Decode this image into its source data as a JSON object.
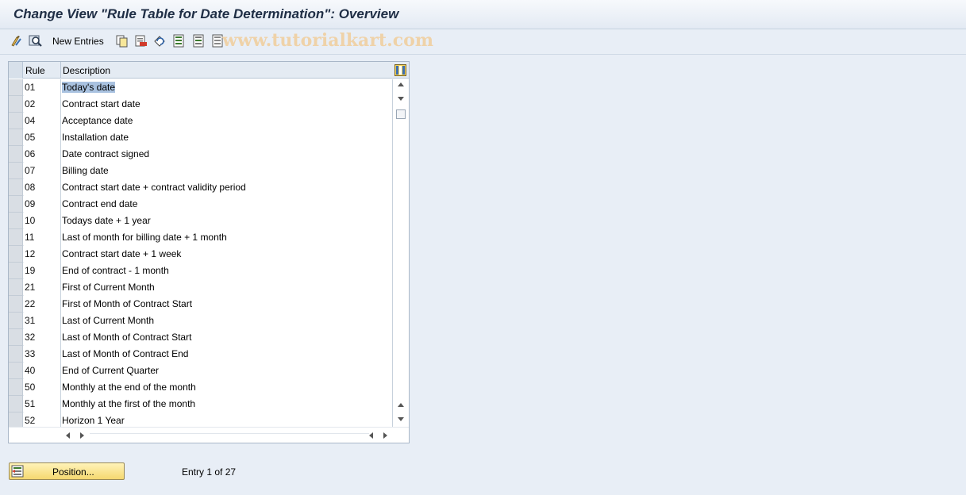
{
  "title": "Change View \"Rule Table for Date Determination\": Overview",
  "toolbar": {
    "icons": [
      "display-change-icon",
      "find-icon",
      "copy-as-icon",
      "delete-icon",
      "undo-icon",
      "select-all-icon",
      "select-block-icon",
      "deselect-all-icon"
    ],
    "new_entries_label": "New Entries",
    "watermark": "www.tutorialkart.com"
  },
  "table": {
    "columns": {
      "rule": "Rule",
      "description": "Description"
    },
    "rows": [
      {
        "rule": "01",
        "description": "Today's date"
      },
      {
        "rule": "02",
        "description": "Contract start date"
      },
      {
        "rule": "04",
        "description": "Acceptance date"
      },
      {
        "rule": "05",
        "description": "Installation date"
      },
      {
        "rule": "06",
        "description": "Date contract signed"
      },
      {
        "rule": "07",
        "description": "Billing date"
      },
      {
        "rule": "08",
        "description": "Contract start date + contract validity period"
      },
      {
        "rule": "09",
        "description": "Contract end date"
      },
      {
        "rule": "10",
        "description": "Todays date + 1 year"
      },
      {
        "rule": "11",
        "description": "Last of month for billing date + 1 month"
      },
      {
        "rule": "12",
        "description": "Contract start date + 1 week"
      },
      {
        "rule": "19",
        "description": "End of contract - 1 month"
      },
      {
        "rule": "21",
        "description": "First of Current Month"
      },
      {
        "rule": "22",
        "description": "First of Month of Contract Start"
      },
      {
        "rule": "31",
        "description": "Last of Current Month"
      },
      {
        "rule": "32",
        "description": "Last of Month of Contract Start"
      },
      {
        "rule": "33",
        "description": "Last of Month of Contract End"
      },
      {
        "rule": "40",
        "description": "End of Current Quarter"
      },
      {
        "rule": "50",
        "description": "Monthly at the end of the month"
      },
      {
        "rule": "51",
        "description": "Monthly at the first of the month"
      },
      {
        "rule": "52",
        "description": "Horizon 1 Year"
      }
    ]
  },
  "footer": {
    "position_button_label": "Position...",
    "entry_text": "Entry 1 of 27"
  }
}
